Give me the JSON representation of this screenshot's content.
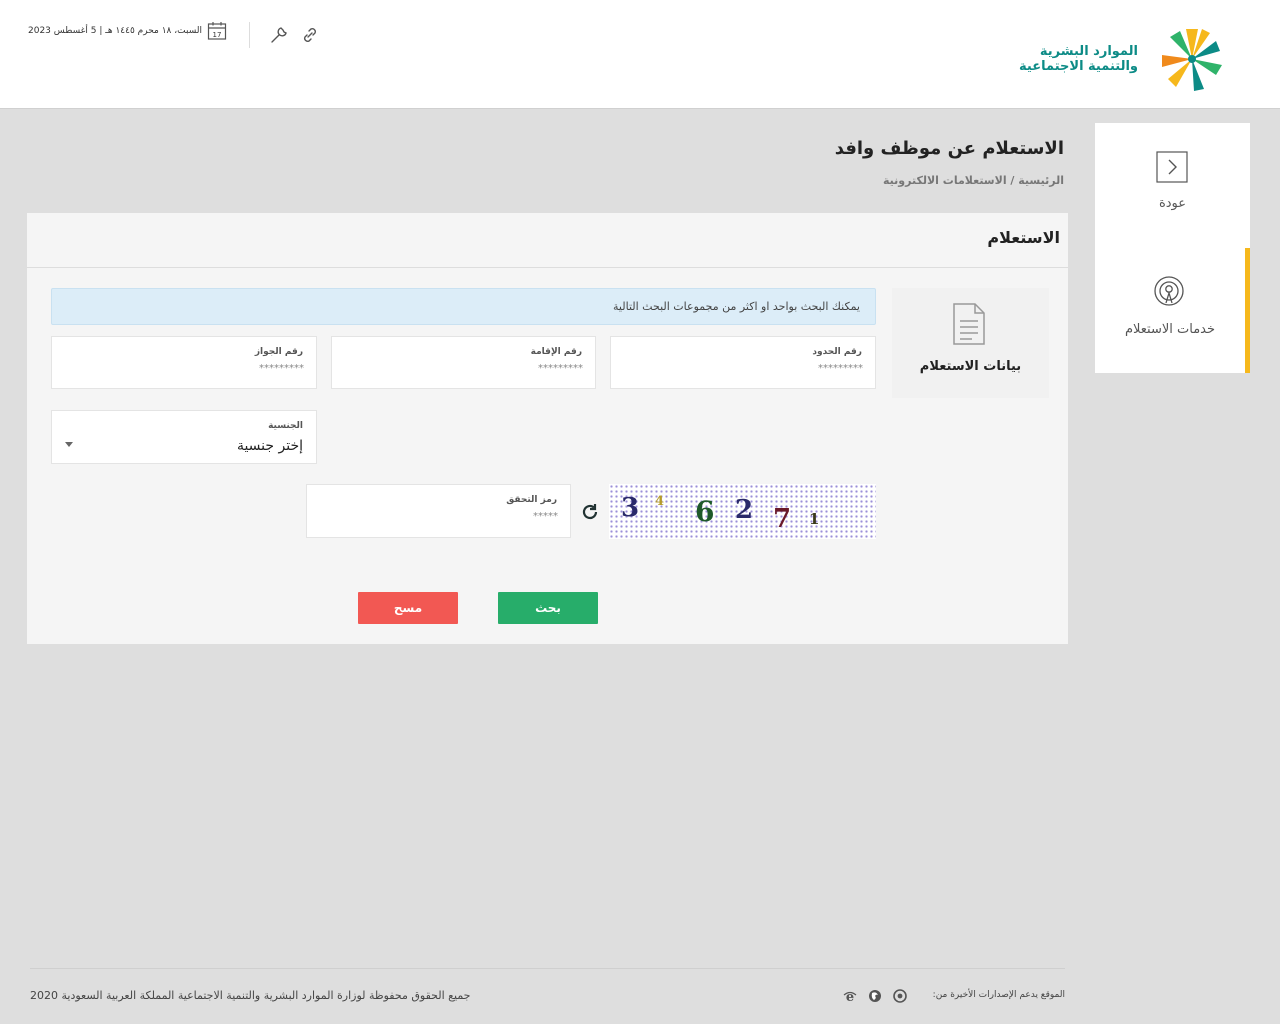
{
  "header": {
    "logo_text_line1": "الموارد البشرية",
    "logo_text_line2": "والتنمية الاجتماعية",
    "date_text": "السبت، ١٨ محرم ١٤٤٥ هـ | 5 أغسطس 2023",
    "calendar_day": "17"
  },
  "sidebar": {
    "back_label": "عودة",
    "services_label": "خدمات الاستعلام"
  },
  "page": {
    "title": "الاستعلام عن موظف وافد",
    "breadcrumb": "الرئيسية / الاستعلامات الالكترونية"
  },
  "panel": {
    "title": "الاستعلام",
    "card_label": "بيانات الاستعلام",
    "info_text": "يمكنك البحث بواحد او اكثر من مجموعات البحث التالية"
  },
  "form": {
    "border_number": {
      "label": "رقم الحدود",
      "placeholder": "*********"
    },
    "iqama_number": {
      "label": "رقم الإقامة",
      "placeholder": "*********"
    },
    "passport_number": {
      "label": "رقم الجواز",
      "placeholder": "*********"
    },
    "nationality": {
      "label": "الجنسية",
      "selected": "إختر جنسية"
    },
    "captcha": {
      "label": "رمز التحقق",
      "placeholder": "*****",
      "chars": [
        "3",
        "4",
        "6",
        "2",
        "7",
        "1"
      ]
    }
  },
  "buttons": {
    "search": "بحث",
    "clear": "مسح"
  },
  "footer": {
    "copyright": "جميع الحقوق محفوظة لوزارة الموارد البشرية والتنمية الاجتماعية المملكة العربية السعودية 2020",
    "browsers_label": "الموقع يدعم الإصدارات الأخيرة من:"
  },
  "colors": {
    "brand_teal": "#0c8b86",
    "accent_yellow": "#f6b81c",
    "search_green": "#27ad6a",
    "clear_red": "#f25853",
    "info_blue": "#dcedf8"
  }
}
